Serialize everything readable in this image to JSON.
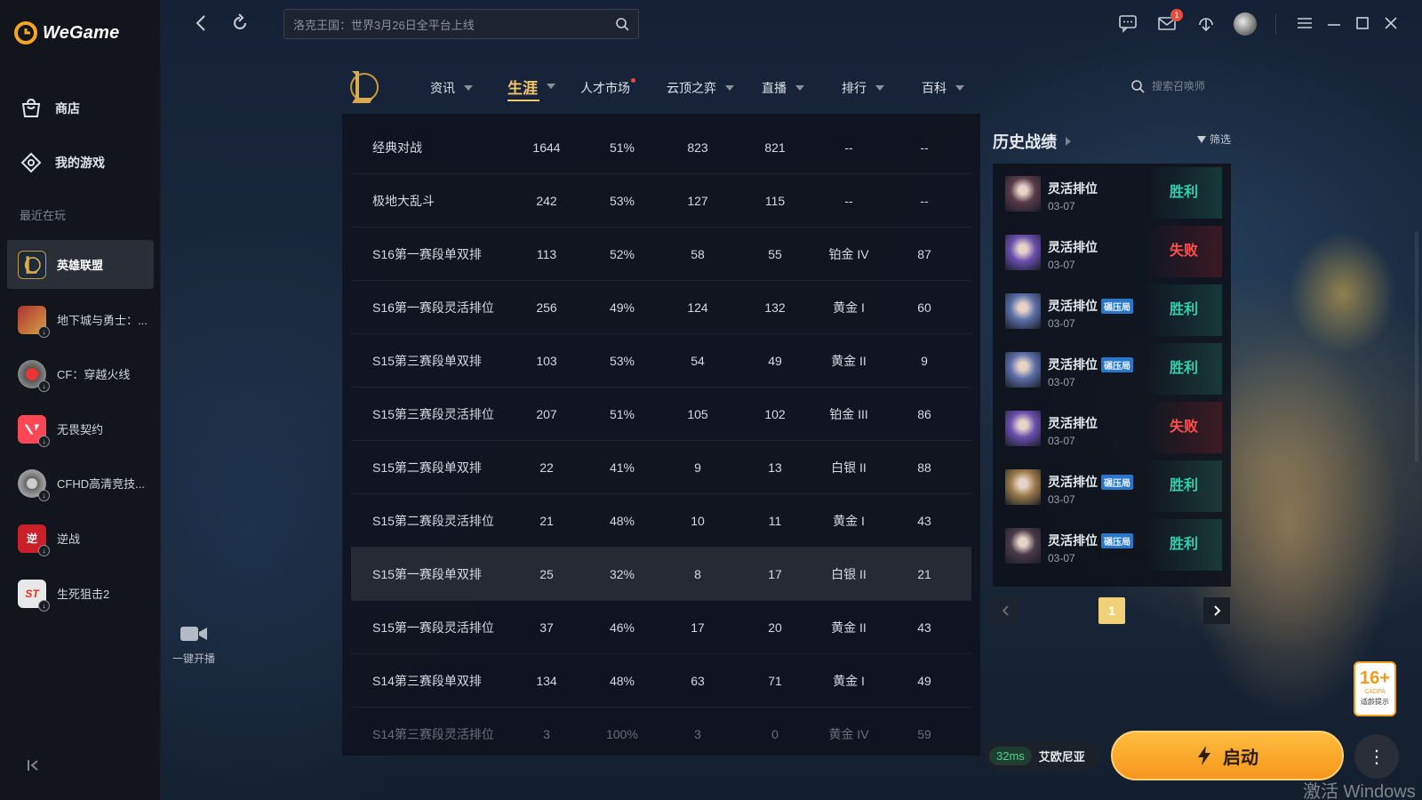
{
  "app": {
    "name": "WeGame"
  },
  "sidebar": {
    "store_label": "商店",
    "mygames_label": "我的游戏",
    "recent_title": "最近在玩",
    "games": [
      {
        "label": "英雄联盟",
        "active": true
      },
      {
        "label": "地下城与勇士：..."
      },
      {
        "label": "CF：穿越火线"
      },
      {
        "label": "无畏契约"
      },
      {
        "label": "CFHD高清竞技..."
      },
      {
        "label": "逆战"
      },
      {
        "label": "生死狙击2"
      }
    ],
    "game_icon_text": [
      "",
      "",
      "",
      "",
      "",
      "逆",
      "ST"
    ]
  },
  "topbar": {
    "search_placeholder": "洛克王国：世界3月26日全平台上线",
    "mail_badge": "1"
  },
  "game_nav": {
    "items": [
      "资讯",
      "生涯",
      "人才市场",
      "云顶之弈",
      "直播",
      "排行",
      "百科"
    ],
    "active": "生涯",
    "search_placeholder": "搜索召唤师"
  },
  "stats_table": {
    "rows": [
      [
        "经典对战",
        "1644",
        "51%",
        "823",
        "821",
        "--",
        "--"
      ],
      [
        "极地大乱斗",
        "242",
        "53%",
        "127",
        "115",
        "--",
        "--"
      ],
      [
        "S16第一赛段单双排",
        "113",
        "52%",
        "58",
        "55",
        "铂金 IV",
        "87"
      ],
      [
        "S16第一赛段灵活排位",
        "256",
        "49%",
        "124",
        "132",
        "黄金 I",
        "60"
      ],
      [
        "S15第三赛段单双排",
        "103",
        "53%",
        "54",
        "49",
        "黄金 II",
        "9"
      ],
      [
        "S15第三赛段灵活排位",
        "207",
        "51%",
        "105",
        "102",
        "铂金 III",
        "86"
      ],
      [
        "S15第二赛段单双排",
        "22",
        "41%",
        "9",
        "13",
        "白银 II",
        "88"
      ],
      [
        "S15第二赛段灵活排位",
        "21",
        "48%",
        "10",
        "11",
        "黄金 I",
        "43"
      ],
      [
        "S15第一赛段单双排",
        "25",
        "32%",
        "8",
        "17",
        "白银 II",
        "21"
      ],
      [
        "S15第一赛段灵活排位",
        "37",
        "46%",
        "17",
        "20",
        "黄金 II",
        "43"
      ],
      [
        "S14第三赛段单双排",
        "134",
        "48%",
        "63",
        "71",
        "黄金 I",
        "49"
      ],
      [
        "S14第三赛段灵活排位",
        "3",
        "100%",
        "3",
        "0",
        "黄金 IV",
        "59"
      ]
    ]
  },
  "history": {
    "title": "历史战绩",
    "filter_label": "筛选",
    "matches": [
      {
        "mode": "灵活排位",
        "date": "03-07",
        "result": "胜利",
        "win": true,
        "tag": "",
        "champ_color": "#5a3a4a"
      },
      {
        "mode": "灵活排位",
        "date": "03-07",
        "result": "失败",
        "win": false,
        "tag": "",
        "champ_color": "#6a4fb0"
      },
      {
        "mode": "灵活排位",
        "date": "03-07",
        "result": "胜利",
        "win": true,
        "tag": "碾压局",
        "champ_color": "#5b6fa8"
      },
      {
        "mode": "灵活排位",
        "date": "03-07",
        "result": "胜利",
        "win": true,
        "tag": "碾压局",
        "champ_color": "#5b6fa8"
      },
      {
        "mode": "灵活排位",
        "date": "03-07",
        "result": "失败",
        "win": false,
        "tag": "",
        "champ_color": "#6a4fb0"
      },
      {
        "mode": "灵活排位",
        "date": "03-07",
        "result": "胜利",
        "win": true,
        "tag": "碾压局",
        "champ_color": "#9a7a4a"
      },
      {
        "mode": "灵活排位",
        "date": "03-07",
        "result": "胜利",
        "win": true,
        "tag": "碾压局",
        "champ_color": "#4a3a48"
      }
    ],
    "page": "1"
  },
  "live": {
    "label": "一键开播"
  },
  "bottom": {
    "ping": "32ms",
    "region": "艾欧尼亚",
    "launch_label": "启动",
    "age_badge": {
      "num": "16+",
      "org": "CADPA",
      "tip": "适龄提示"
    },
    "watermark": "激活 Windows"
  },
  "colors": {
    "accent_gold": "#f1c46a",
    "win": "#2fd0b1",
    "loss": "#ff4f4f",
    "launch": "#f5a52a"
  }
}
